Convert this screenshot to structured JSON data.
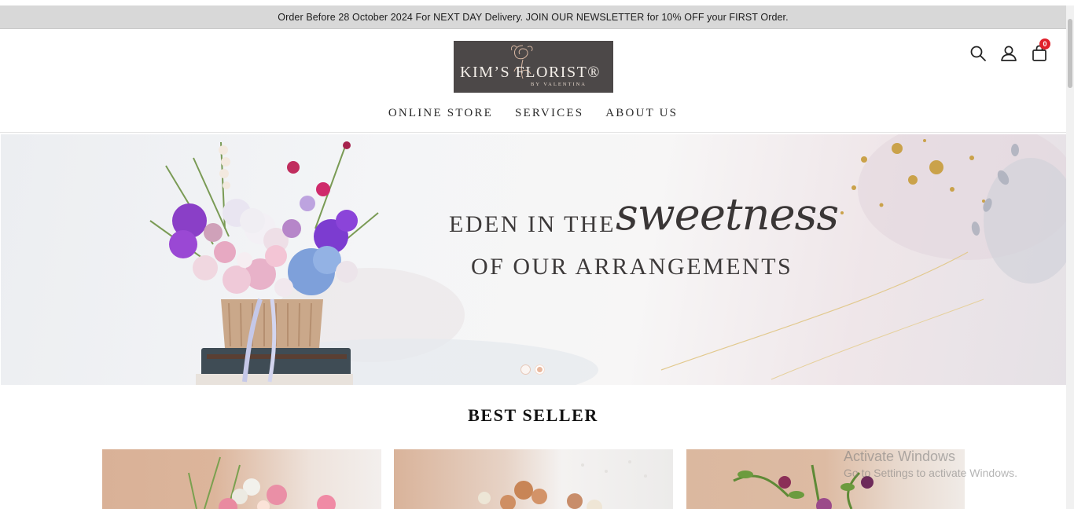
{
  "announcement": "Order Before 28 October 2024 For NEXT DAY Delivery. JOIN OUR NEWSLETTER for 10% OFF your FIRST Order.",
  "logo": {
    "brand": "KIM’S FLORIST®",
    "sub": "BY VALENTINA"
  },
  "nav": [
    "ONLINE STORE",
    "SERVICES",
    "ABOUT US"
  ],
  "header_icons": {
    "search": "search-icon",
    "account": "user-icon",
    "cart": "shopping-bag-icon",
    "cart_count": "0"
  },
  "hero": {
    "line1": "EDEN IN THE",
    "script": "sweetness",
    "line2": "OF OUR ARRANGEMENTS",
    "slides": 2,
    "active_slide": 2
  },
  "best_seller": {
    "title": "BEST SELLER"
  },
  "watermark": {
    "title": "Activate Windows",
    "subtitle": "Go to Settings to activate Windows."
  },
  "colors": {
    "announce_bg": "#d8d8d8",
    "logo_bg": "#4c4848",
    "badge": "#e0202b",
    "text": "#2a2a2a"
  }
}
